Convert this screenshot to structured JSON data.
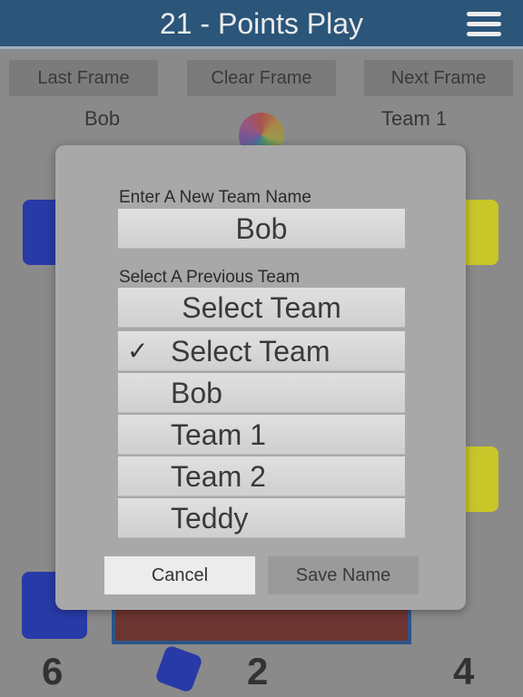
{
  "header": {
    "title": "21 - Points Play"
  },
  "frame_buttons": {
    "last": "Last Frame",
    "clear": "Clear Frame",
    "next": "Next Frame"
  },
  "board": {
    "left_team": "Bob",
    "right_team": "Team 1",
    "bottom_scores": [
      "6",
      "2",
      "4"
    ],
    "colors": {
      "left_bag": "#1a2fb0",
      "right_bag": "#d8d41c",
      "board": "#6b2a26"
    }
  },
  "dialog": {
    "new_team_label": "Enter A New Team Name",
    "new_team_value": "Bob",
    "previous_team_label": "Select A Previous Team",
    "select_value": "Select Team",
    "options": [
      {
        "label": "Select Team",
        "selected": true
      },
      {
        "label": "Bob",
        "selected": false
      },
      {
        "label": "Team 1",
        "selected": false
      },
      {
        "label": "Team 2",
        "selected": false
      },
      {
        "label": "Teddy",
        "selected": false
      }
    ],
    "check_icon": "✓",
    "cancel_label": "Cancel",
    "save_label": "Save Name"
  }
}
